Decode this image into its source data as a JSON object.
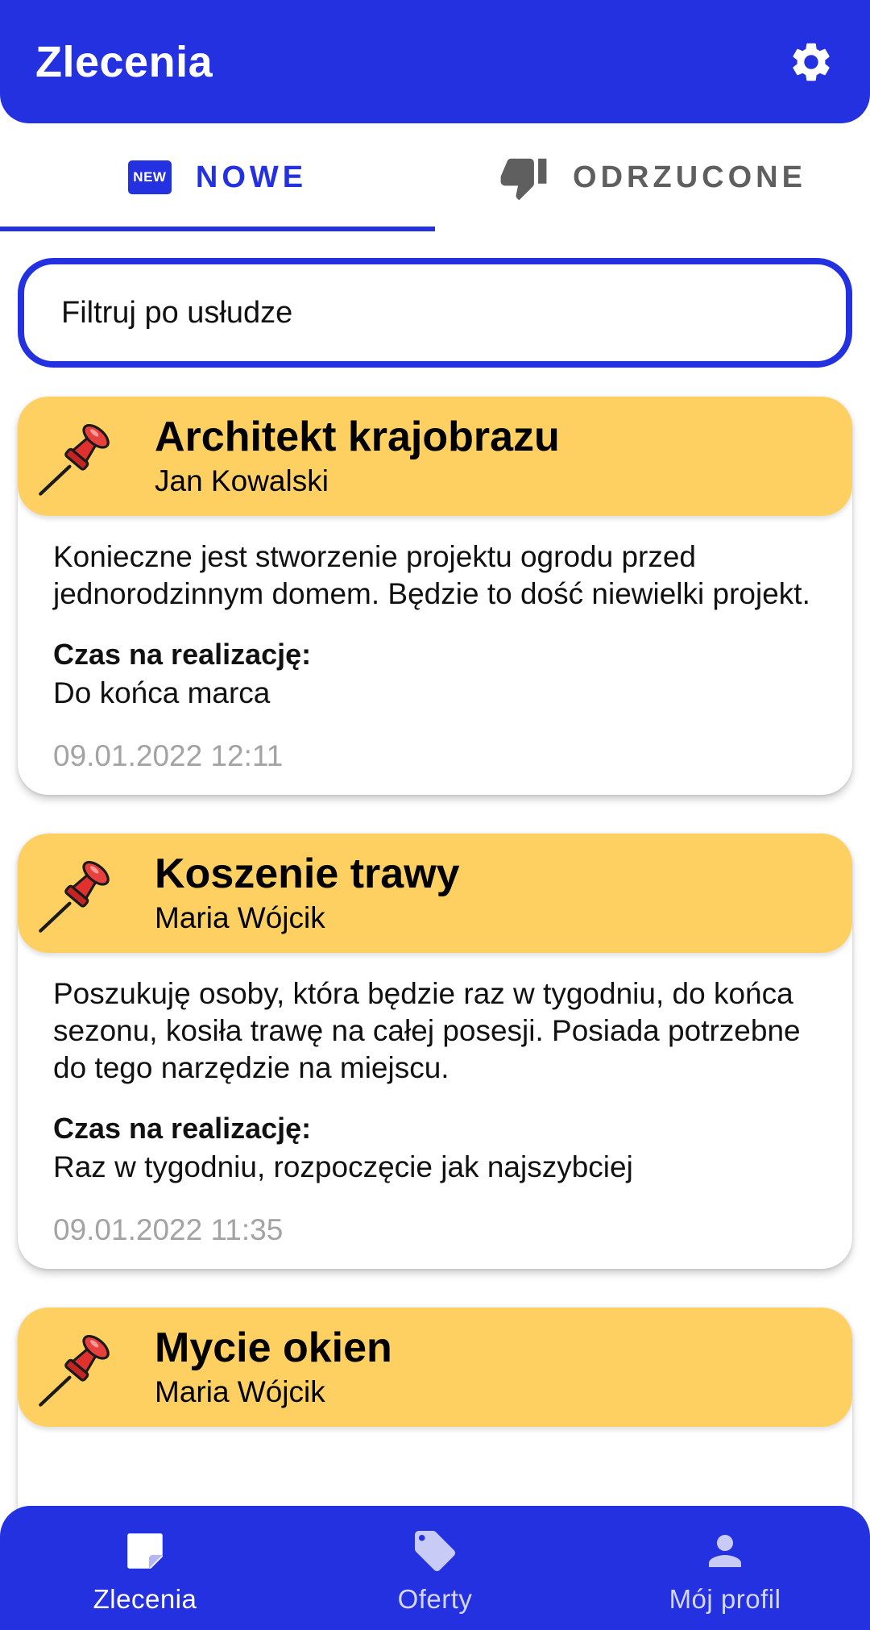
{
  "app_bar": {
    "title": "Zlecenia",
    "settings_icon": "gear-icon"
  },
  "tabs": [
    {
      "label": "NOWE",
      "icon": "new-badge-icon",
      "icon_text": "NEW",
      "active": true
    },
    {
      "label": "ODRZUCONE",
      "icon": "thumb-down-icon",
      "active": false
    }
  ],
  "filter": {
    "placeholder": "Filtruj po usłudze",
    "value": ""
  },
  "orders": [
    {
      "title": "Architekt krajobrazu",
      "author": "Jan Kowalski",
      "description": "Konieczne jest stworzenie projektu ogrodu przed jednorodzinnym domem. Będzie to dość niewielki projekt.",
      "time_label": "Czas na realizację:",
      "time_value": "Do końca marca",
      "date": "09.01.2022 12:11"
    },
    {
      "title": "Koszenie trawy",
      "author": "Maria Wójcik",
      "description": "Poszukuję osoby, która będzie raz w tygodniu, do końca sezonu, kosiła trawę na całej posesji. Posiada potrzebne do tego narzędzie na miejscu.",
      "time_label": "Czas na realizację:",
      "time_value": "Raz w tygodniu, rozpoczęcie jak najszybciej",
      "date": "09.01.2022 11:35"
    },
    {
      "title": "Mycie okien",
      "author": "Maria Wójcik"
    }
  ],
  "bottom_nav": [
    {
      "label": "Zlecenia",
      "icon": "note-icon",
      "active": true
    },
    {
      "label": "Oferty",
      "icon": "tag-icon",
      "active": false
    },
    {
      "label": "Mój profil",
      "icon": "person-icon",
      "active": false
    }
  ],
  "colors": {
    "primary": "#2431e0",
    "card_header": "#fdd061",
    "date_text": "#a3a3a3",
    "pin_red": "#e0312e"
  }
}
